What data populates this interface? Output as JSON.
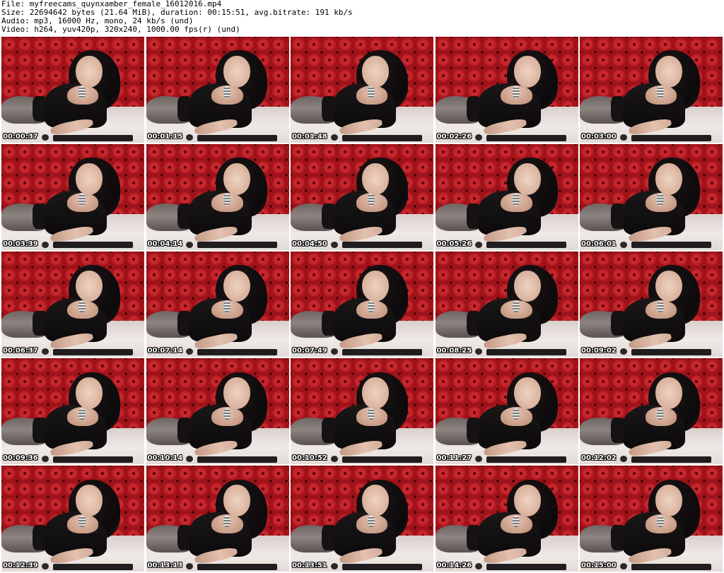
{
  "header": {
    "file_line": "File: myfreecams_quynxamber_female_16012016.mp4",
    "size_line": "Size: 22694642 bytes (21.64 MiB), duration: 00:15:51, avg.bitrate: 191 kb/s",
    "audio_line": "Audio: mp3, 16000 Hz, mono, 24 kb/s (und)",
    "video_line": "Video: h264, yuv420p, 320x240, 1000.00 fps(r) (und)"
  },
  "colors": {
    "background": "#ffffff",
    "header_text": "#000000",
    "backdrop_red": "#a3141b",
    "timestamp_text": "#ffffff",
    "timestamp_outline": "#000000"
  },
  "thumbnails": [
    {
      "timestamp": "00:00:37"
    },
    {
      "timestamp": "00:01:15"
    },
    {
      "timestamp": "00:01:48"
    },
    {
      "timestamp": "00:02:26"
    },
    {
      "timestamp": "00:03:00"
    },
    {
      "timestamp": "00:03:39"
    },
    {
      "timestamp": "00:04:14"
    },
    {
      "timestamp": "00:04:50"
    },
    {
      "timestamp": "00:05:26"
    },
    {
      "timestamp": "00:06:01"
    },
    {
      "timestamp": "00:06:37"
    },
    {
      "timestamp": "00:07:14"
    },
    {
      "timestamp": "00:07:49"
    },
    {
      "timestamp": "00:08:25"
    },
    {
      "timestamp": "00:09:02"
    },
    {
      "timestamp": "00:09:36"
    },
    {
      "timestamp": "00:10:14"
    },
    {
      "timestamp": "00:10:52"
    },
    {
      "timestamp": "00:11:27"
    },
    {
      "timestamp": "00:12:02"
    },
    {
      "timestamp": "00:12:39"
    },
    {
      "timestamp": "00:13:13"
    },
    {
      "timestamp": "00:13:51"
    },
    {
      "timestamp": "00:14:26"
    },
    {
      "timestamp": "00:15:00"
    }
  ]
}
